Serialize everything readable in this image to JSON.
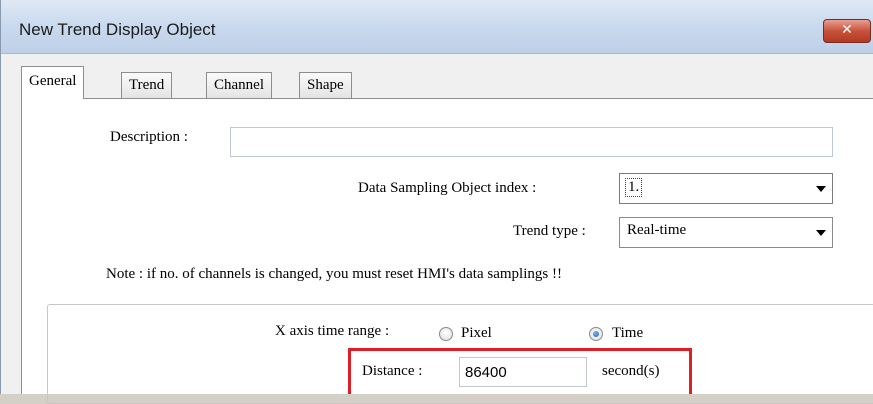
{
  "window": {
    "title": "New  Trend Display Object",
    "close_label": "✕"
  },
  "tabs": [
    {
      "label": "General",
      "active": true
    },
    {
      "label": "Trend",
      "active": false
    },
    {
      "label": "Channel",
      "active": false
    },
    {
      "label": "Shape",
      "active": false
    }
  ],
  "general": {
    "description_label": "Description :",
    "description_value": "",
    "sampling_label": "Data Sampling Object index :",
    "sampling_value": "1.",
    "trend_type_label": "Trend type :",
    "trend_type_value": "Real-time",
    "note": "Note : if no. of channels is changed, you must reset HMI's  data samplings !!",
    "x_axis_label": "X axis time range :",
    "radio_pixel": "Pixel",
    "radio_time": "Time",
    "x_axis_selected": "Time",
    "distance_label": "Distance :",
    "distance_value": "86400",
    "distance_unit": "second(s)"
  },
  "colors": {
    "highlight": "#e01e25",
    "titlebar": "#c9d9ee",
    "close_button": "#c7523c"
  }
}
